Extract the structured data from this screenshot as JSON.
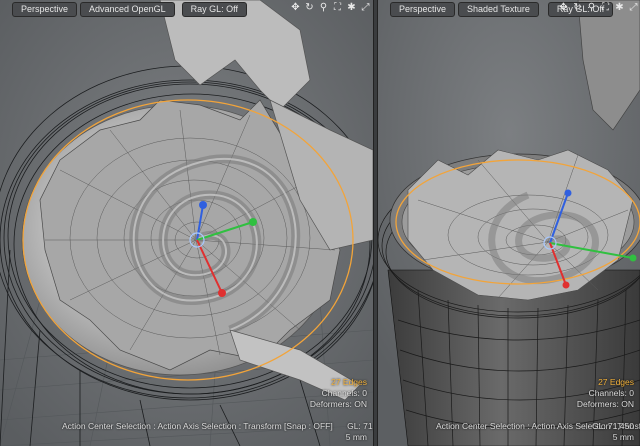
{
  "left_viewport": {
    "view_mode": "Perspective",
    "render_mode": "Advanced OpenGL",
    "ray_gl": "Ray GL: Off",
    "selection_count": "27 Edges",
    "channels": "Channels: 0",
    "deformers": "Deformers: ON",
    "gl_polys": "GL: 71,450",
    "status": "Action Center Selection : Action Axis Selection : Transform  [Snap : OFF]",
    "grid_size": "5 mm"
  },
  "right_viewport": {
    "view_mode": "Perspective",
    "render_mode": "Shaded Texture",
    "ray_gl": "Ray GL: Off",
    "selection_count": "27 Edges",
    "channels": "Channels: 0",
    "deformers": "Deformers: ON",
    "gl_polys": "GL: 71,450",
    "status": "Action Center Selection : Action Axis Selection : Transform",
    "grid_size": "5 mm"
  },
  "toolbar_icons": [
    "move-icon",
    "rotate-icon",
    "zoom-icon",
    "fit-icon",
    "settings-icon",
    "maximize-icon"
  ],
  "colors": {
    "viewport_bg": "#6e7174",
    "selection_highlight": "#f2a43a",
    "axis_x": "#e03030",
    "axis_y": "#30c040",
    "axis_z": "#3060e0"
  }
}
